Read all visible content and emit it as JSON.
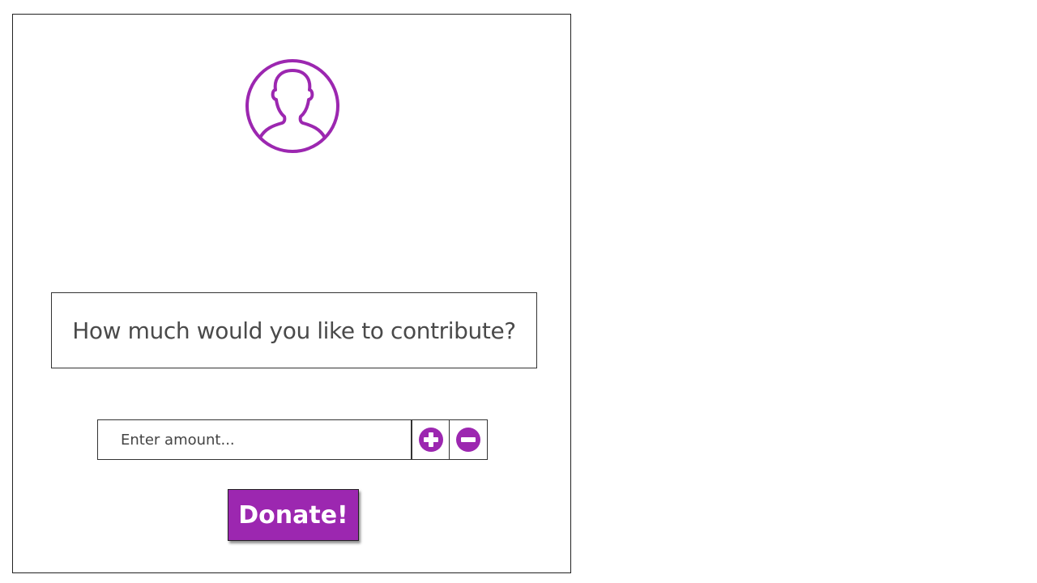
{
  "profile": {
    "avatar_icon": "user-silhouette-icon",
    "accent_color": "#9c27b0"
  },
  "question": {
    "text": "How much would you like to contribute?"
  },
  "amount": {
    "value": "",
    "placeholder": "Enter amount...",
    "increment_icon": "plus-circle-icon",
    "decrement_icon": "minus-circle-icon"
  },
  "donate": {
    "label": "Donate!",
    "color": "#9c27b0"
  }
}
